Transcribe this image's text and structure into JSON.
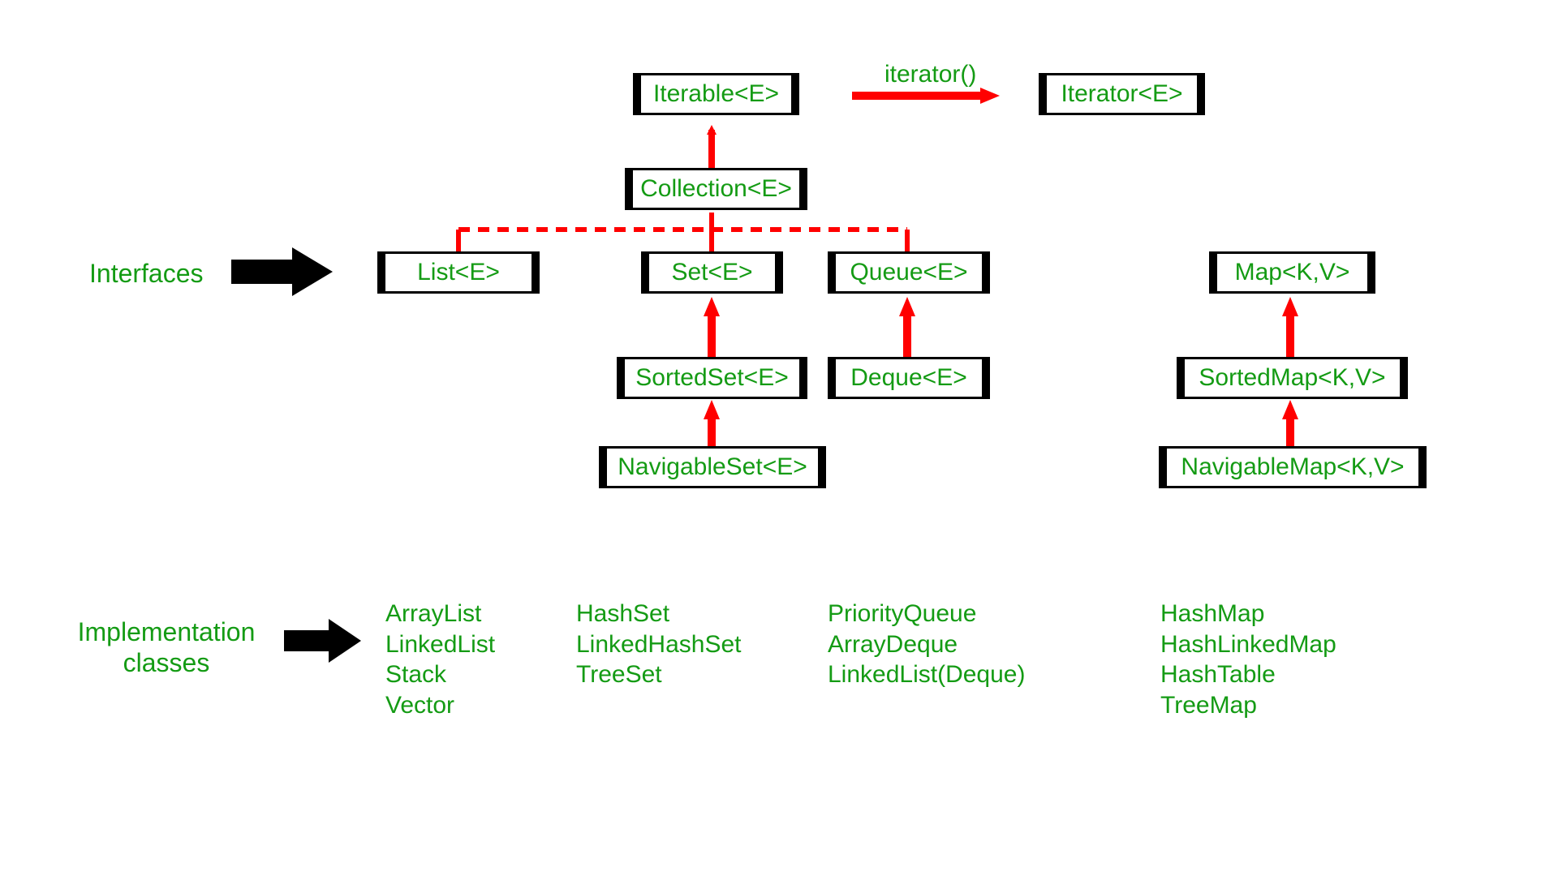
{
  "labels": {
    "interfaces": "Interfaces",
    "implementation_classes_l1": "Implementation",
    "implementation_classes_l2": "classes",
    "iterator_method": "iterator()"
  },
  "boxes": {
    "iterable": "Iterable<E>",
    "iterator": "Iterator<E>",
    "collection": "Collection<E>",
    "list": "List<E>",
    "set": "Set<E>",
    "queue": "Queue<E>",
    "sortedset": "SortedSet<E>",
    "deque": "Deque<E>",
    "navigableset": "NavigableSet<E>",
    "map": "Map<K,V>",
    "sortedmap": "SortedMap<K,V>",
    "navigablemap": "NavigableMap<K,V>"
  },
  "impl": {
    "list": [
      "ArrayList",
      "LinkedList",
      "Stack",
      "Vector"
    ],
    "set": [
      "HashSet",
      "LinkedHashSet",
      "TreeSet"
    ],
    "queue": [
      "PriorityQueue",
      "ArrayDeque",
      "LinkedList(Deque)"
    ],
    "map": [
      "HashMap",
      "HashLinkedMap",
      "HashTable",
      "TreeMap"
    ]
  }
}
